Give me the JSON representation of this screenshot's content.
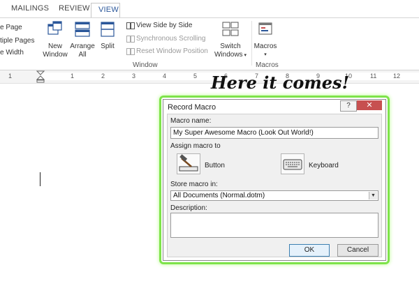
{
  "tabs": [
    {
      "label": "MAILINGS"
    },
    {
      "label": "REVIEW"
    },
    {
      "label": "VIEW"
    }
  ],
  "ribbon": {
    "left_items": [
      "e Page",
      "tiple Pages",
      "e Width"
    ],
    "new_window": {
      "line1": "New",
      "line2": "Window"
    },
    "arrange_all": {
      "line1": "Arrange",
      "line2": "All"
    },
    "split": {
      "label": "Split"
    },
    "view_side_by_side": "View Side by Side",
    "synchronous_scrolling": "Synchronous Scrolling",
    "reset_window_position": "Reset Window Position",
    "switch_windows": {
      "line1": "Switch",
      "line2": "Windows"
    },
    "macros": {
      "label": "Macros"
    },
    "group_window": "Window",
    "group_macros": "Macros"
  },
  "ruler": {
    "numbers": [
      "1",
      "2",
      "3",
      "4",
      "5",
      "6",
      "7",
      "8",
      "9",
      "10",
      "11",
      "12"
    ]
  },
  "annotation": "Here it comes!",
  "dialog": {
    "title": "Record Macro",
    "help": "?",
    "close": "✕",
    "macro_name_label": "Macro name:",
    "macro_name_value": "My Super Awesome Macro (Look Out World!)",
    "assign_label": "Assign macro to",
    "button_label": "Button",
    "keyboard_label": "Keyboard",
    "store_label": "Store macro in:",
    "store_value": "All Documents (Normal.dotm)",
    "description_label": "Description:",
    "ok": "OK",
    "cancel": "Cancel"
  },
  "colors": {
    "accent": "#2b579a",
    "highlight": "#7ee34a",
    "close": "#c75050"
  }
}
